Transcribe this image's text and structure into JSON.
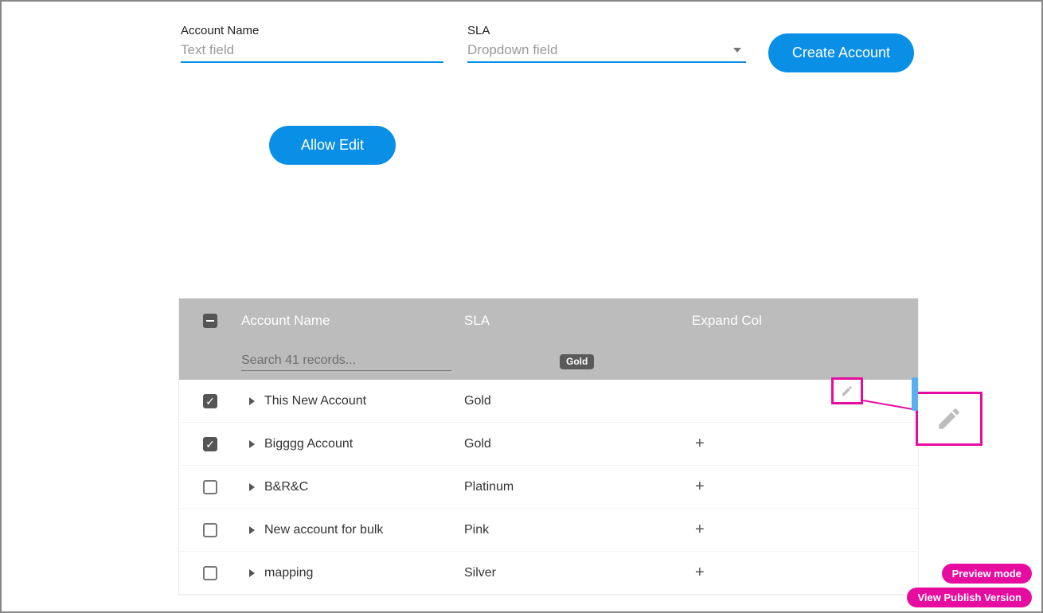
{
  "form": {
    "account_name_label": "Account Name",
    "account_name_placeholder": "Text field",
    "sla_label": "SLA",
    "sla_placeholder": "Dropdown field",
    "create_button": "Create Account",
    "allow_edit_button": "Allow Edit"
  },
  "grid": {
    "headers": {
      "name": "Account Name",
      "sla": "SLA",
      "expand": "Expand Col"
    },
    "search_placeholder": "Search 41 records...",
    "filter_chip": "Gold",
    "rows": [
      {
        "checked": true,
        "name": "This New Account",
        "sla": "Gold",
        "action": "edit"
      },
      {
        "checked": true,
        "name": "Bigggg Account",
        "sla": "Gold",
        "action": "plus"
      },
      {
        "checked": false,
        "name": "B&R&C",
        "sla": "Platinum",
        "action": "plus"
      },
      {
        "checked": false,
        "name": "New account for bulk",
        "sla": "Pink",
        "action": "plus"
      },
      {
        "checked": false,
        "name": "mapping",
        "sla": "Silver",
        "action": "plus"
      }
    ]
  },
  "badges": {
    "preview": "Preview mode",
    "publish": "View Publish Version"
  }
}
